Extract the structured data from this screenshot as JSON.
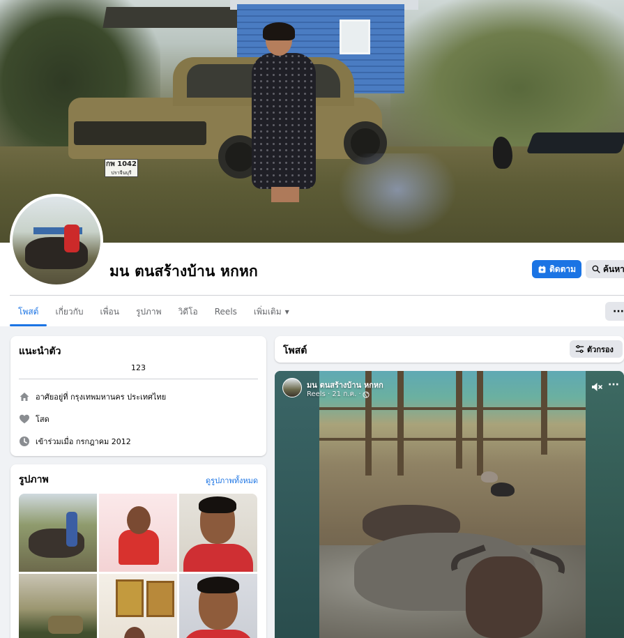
{
  "cover": {
    "plate_number": "กพ 1042",
    "plate_province": "ปราจีนบุรี"
  },
  "profile": {
    "name": "มน ตนสร้างบ้าน หกหก",
    "follow_label": "ติดตาม",
    "search_label": "ค้นหา"
  },
  "tabs": [
    {
      "label": "โพสต์",
      "active": true
    },
    {
      "label": "เกี่ยวกับ"
    },
    {
      "label": "เพื่อน"
    },
    {
      "label": "รูปภาพ"
    },
    {
      "label": "วิดีโอ"
    },
    {
      "label": "Reels"
    },
    {
      "label": "เพิ่มเติม"
    }
  ],
  "more_button": "···",
  "intro": {
    "title": "แนะนำตัว",
    "bio": "123",
    "lives_in": "อาศัยอยู่ที่ กรุงเทพมหานคร ประเทศไทย",
    "relationship": "โสด",
    "joined": "เข้าร่วมเมื่อ กรกฎาคม 2012"
  },
  "photos": {
    "title": "รูปภาพ",
    "see_all": "ดูรูปภาพทั้งหมด"
  },
  "posts": {
    "title": "โพสต์",
    "filter_label": "ตัวกรอง"
  },
  "reel": {
    "author": "มน ตนสร้างบ้าน หกหก",
    "meta": "Reels · 21 ก.ค. ·",
    "more": "···"
  },
  "colors": {
    "accent": "#1b74e4",
    "page_bg": "#f0f2f5",
    "secondary_text": "#65676b"
  }
}
